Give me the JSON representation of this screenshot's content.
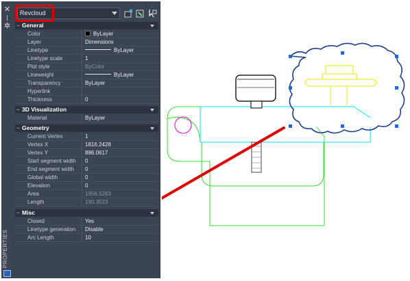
{
  "strip": {
    "close_icon": "✕",
    "pin_icon": "⁞",
    "settings_icon": "✲",
    "title": "PROPERTIES"
  },
  "selector": {
    "value": "Revcloud"
  },
  "sections": {
    "general": "General",
    "viz3d": "3D Visualization",
    "geometry": "Geometry",
    "misc": "Misc"
  },
  "general": [
    {
      "key": "Color",
      "value": "ByLayer"
    },
    {
      "key": "Layer",
      "value": "Dimensions"
    },
    {
      "key": "Linetype",
      "value": "ByLayer"
    },
    {
      "key": "Linetype scale",
      "value": "1"
    },
    {
      "key": "Plot style",
      "value": "ByColor"
    },
    {
      "key": "Lineweight",
      "value": "ByLayer"
    },
    {
      "key": "Transparency",
      "value": "ByLayer"
    },
    {
      "key": "Hyperlink",
      "value": ""
    },
    {
      "key": "Thickness",
      "value": "0"
    }
  ],
  "viz3d": [
    {
      "key": "Material",
      "value": "ByLayer"
    }
  ],
  "geometry": [
    {
      "key": "Current Vertex",
      "value": "1"
    },
    {
      "key": "Vertex X",
      "value": "1816.2428"
    },
    {
      "key": "Vertex Y",
      "value": "886.0617"
    },
    {
      "key": "Start segment width",
      "value": "0"
    },
    {
      "key": "End segment width",
      "value": "0"
    },
    {
      "key": "Global width",
      "value": "0"
    },
    {
      "key": "Elevation",
      "value": "0"
    },
    {
      "key": "Area",
      "value": "1956.5283"
    },
    {
      "key": "Length",
      "value": "190.3523"
    }
  ],
  "misc": [
    {
      "key": "Closed",
      "value": "Yes"
    },
    {
      "key": "Linetype generation",
      "value": "Disable"
    },
    {
      "key": "Arc Length",
      "value": "10"
    }
  ],
  "colors": {
    "panel_bg": "#3b4453",
    "highlight": "#e00000",
    "revcloud": "#1e3f8f",
    "grip": "#1a6be0",
    "cyan": "#00e5ff",
    "green": "#33e033",
    "yellow": "#e8e800",
    "magenta": "#e000e0"
  },
  "icons": [
    "close-icon",
    "pin-icon",
    "settings-icon",
    "dropdown-icon",
    "quick-select-icon",
    "select-objects-icon",
    "pickadd-icon",
    "properties-icon"
  ]
}
